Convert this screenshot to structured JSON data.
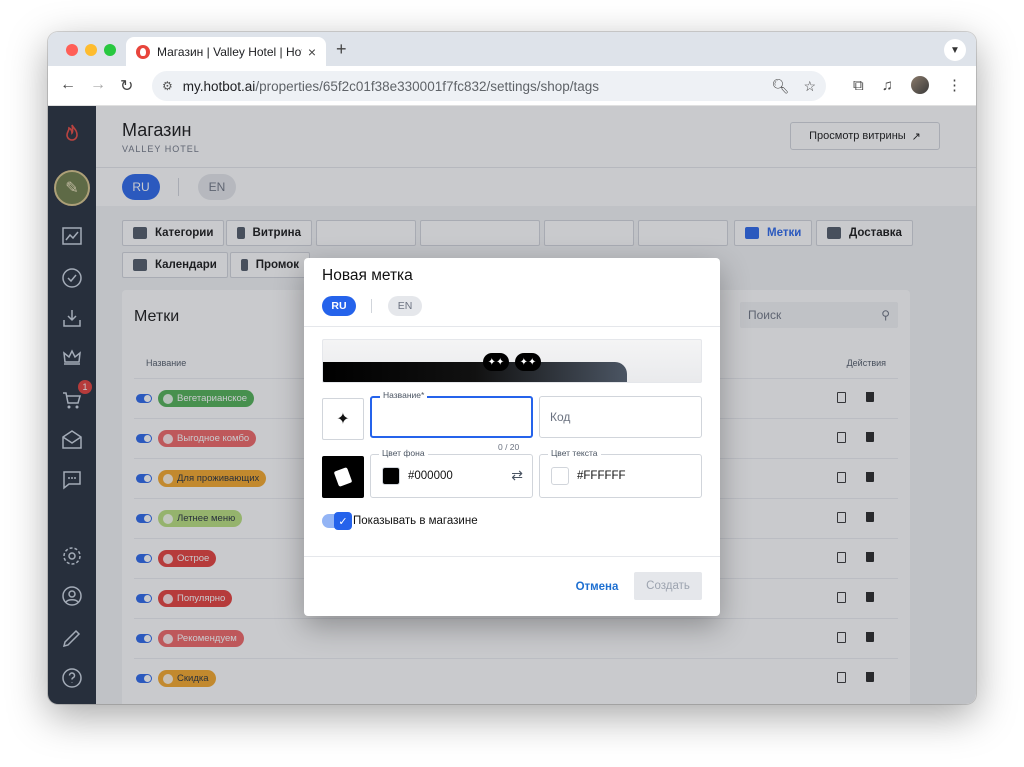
{
  "browser": {
    "tab_title": "Магазин | Valley Hotel | Hotb",
    "tab_close": "×",
    "new_tab": "+",
    "url_host": "my.hotbot.ai",
    "url_path": "/properties/65f2c01f38e330001f7fc832/settings/shop/tags"
  },
  "sidebar": {
    "cart_badge": "1",
    "user_initial": "✎"
  },
  "header": {
    "title": "Магазин",
    "subtitle": "VALLEY HOTEL",
    "preview_button": "Просмотр витрины",
    "preview_arrow": "↗"
  },
  "languages": {
    "ru": "RU",
    "en": "EN"
  },
  "tabs": [
    {
      "label": "Категории"
    },
    {
      "label": "Витрина"
    },
    {
      "label": "Метки"
    },
    {
      "label": "Доставка"
    },
    {
      "label": "Календари"
    },
    {
      "label": "Промок"
    }
  ],
  "card": {
    "title": "Метки",
    "search_placeholder": "Поиск",
    "col_name": "Название",
    "col_actions": "Действия",
    "rows": [
      {
        "label": "Вегетарианское",
        "color": "#4caf50",
        "text_color": "#ffffff"
      },
      {
        "label": "Выгодное комбо",
        "color": "#f06262",
        "text_color": "#ffffff"
      },
      {
        "label": "Для проживающих",
        "color": "#f5a623",
        "text_color": "#1f2937"
      },
      {
        "label": "Летнее меню",
        "color": "#b8e07a",
        "text_color": "#1f2937"
      },
      {
        "label": "Острое",
        "color": "#e53935",
        "text_color": "#ffffff"
      },
      {
        "label": "Популярно",
        "color": "#e53935",
        "text_color": "#ffffff"
      },
      {
        "label": "Рекомендуем",
        "color": "#f06262",
        "text_color": "#ffffff"
      },
      {
        "label": "Скидка",
        "color": "#f5a623",
        "text_color": "#1f2937"
      }
    ]
  },
  "dialog": {
    "title": "Новая метка",
    "lang_ru": "RU",
    "lang_en": "EN",
    "sparkle": "✦✦",
    "ai_icon": "✦",
    "name_label": "Название*",
    "name_value": "",
    "name_counter": "0 / 20",
    "code_placeholder": "Код",
    "bg_label": "Цвет фона",
    "bg_value": "#000000",
    "text_label": "Цвет текста",
    "text_value": "#FFFFFF",
    "swap": "⇄",
    "show_label": "Показывать в магазине",
    "show_check": "✓",
    "cancel": "Отмена",
    "create": "Создать"
  }
}
